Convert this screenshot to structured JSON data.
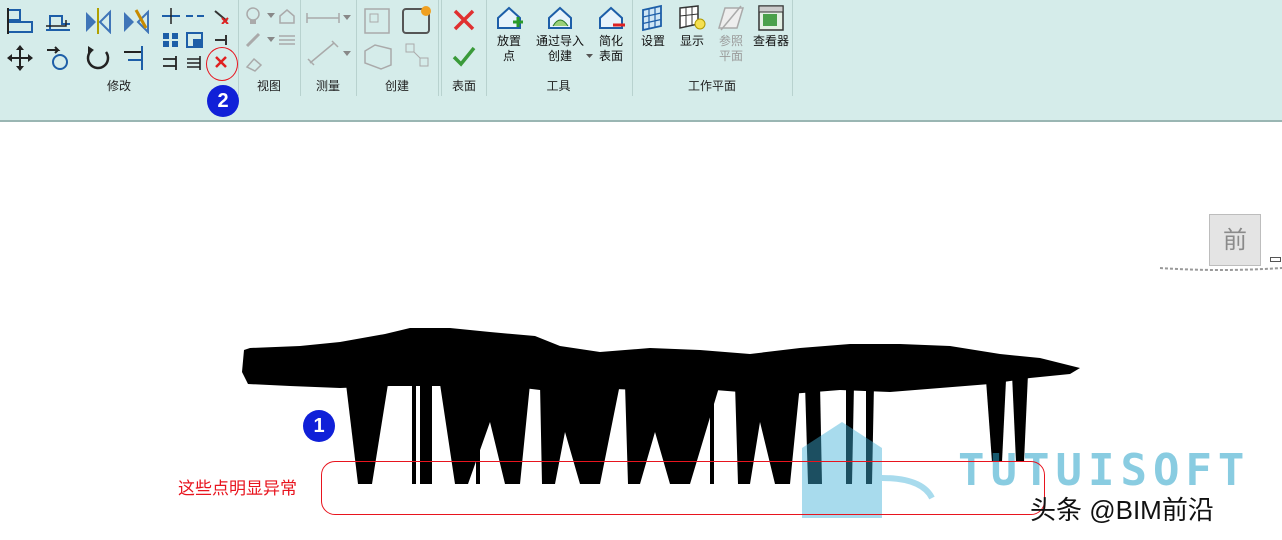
{
  "ribbon": {
    "panels": {
      "modify": "修改",
      "view": "视图",
      "measure": "测量",
      "create": "创建",
      "surface": "表面",
      "tools": "工具",
      "workplane": "工作平面"
    },
    "buttons": {
      "place_point_1": "放置",
      "place_point_2": "点",
      "create_from_import_1": "通过导入",
      "create_from_import_2": "创建",
      "simplify_surface_1": "简化",
      "simplify_surface_2": "表面",
      "set": "设置",
      "show": "显示",
      "ref_plane_1": "参照",
      "ref_plane_2": "平面",
      "viewer": "查看器"
    }
  },
  "viewcube": {
    "face": "前"
  },
  "annotations": {
    "badge_1": "1",
    "badge_2": "2",
    "note": "这些点明显异常"
  },
  "watermark": {
    "brand": "TUTUISOFT",
    "author": "头条 @BIM前沿"
  },
  "colors": {
    "ribbon_bg": "#d5ecea",
    "annotation_red": "#e8141e",
    "badge_blue": "#1020d8",
    "cancel_red": "#e03030",
    "finish_green": "#3a9a3a"
  }
}
